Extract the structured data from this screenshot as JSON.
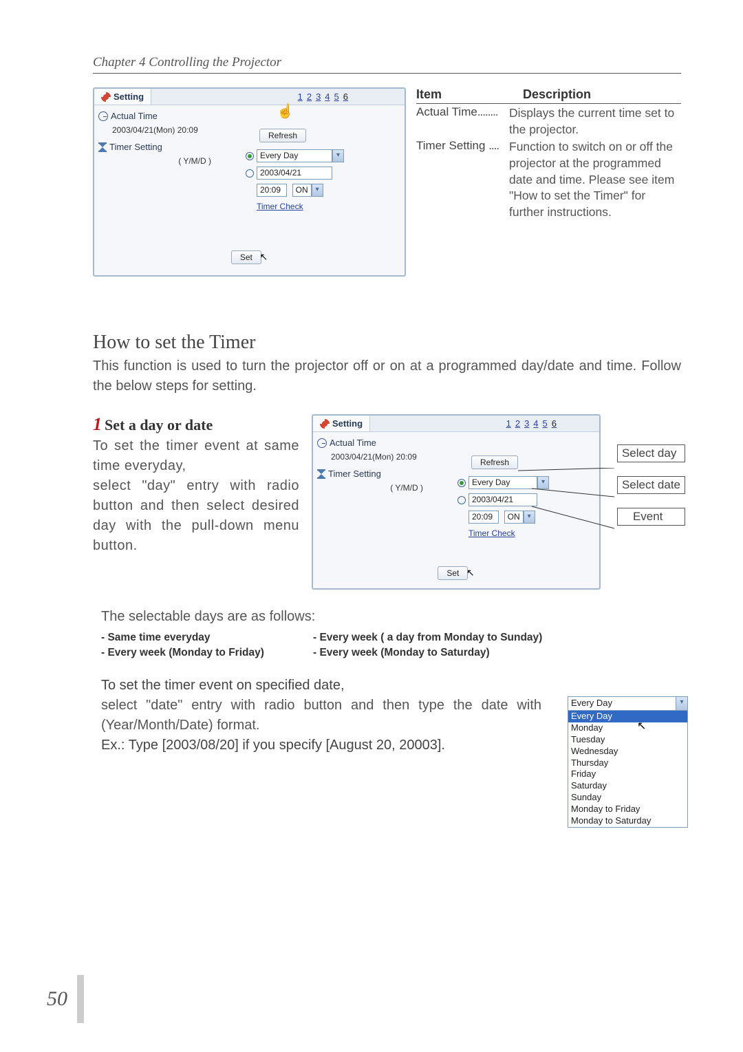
{
  "chapter": "Chapter 4 Controlling the Projector",
  "page_number": "50",
  "panel": {
    "tab_label": "Setting",
    "page_links": [
      "1",
      "2",
      "3",
      "4",
      "5",
      "6"
    ],
    "current_link": "6",
    "actual_time_label": "Actual Time",
    "actual_time_value": "2003/04/21(Mon) 20:09",
    "refresh_btn": "Refresh",
    "timer_setting_label": "Timer Setting",
    "ymd_label": "( Y/M/D )",
    "day_select_value": "Every Day",
    "date_input_value": "2003/04/21",
    "time_input_value": "20:09",
    "event_select_value": "ON",
    "timer_check_link": "Timer Check",
    "set_btn": "Set"
  },
  "desc_table": {
    "hdr_item": "Item",
    "hdr_desc": "Description",
    "row1_item": "Actual Time",
    "row1_dots": "........",
    "row1_desc": "Displays the current time set to the projector.",
    "row2_item": "Timer Setting",
    "row2_dots": "....",
    "row2_desc": "Function to switch on or off the projector at the programmed date and time. Please see item \"How to set the Timer\" for further instructions."
  },
  "section_title": "How to set the Timer",
  "section_intro": "This function is used to turn the projector off or on at a programmed day/date and time. Follow the below steps for setting.",
  "step1": {
    "num": "1",
    "title": "Set a day or date",
    "line1": "To set the timer event at same time everyday,",
    "line2": "select \"day\" entry with radio button and then select desired day with the pull-down menu button."
  },
  "callouts": {
    "select_day": "Select day",
    "select_date": "Select date",
    "event": "Event"
  },
  "selectable_heading": "The selectable days are as follows:",
  "day_options_list": [
    "Same time everyday",
    "Every week ( a day from Monday to Sunday)",
    "Every week (Monday to Friday)",
    "Every week (Monday to Saturday)"
  ],
  "dropdown": {
    "top_value": "Every Day",
    "items": [
      "Every Day",
      "Monday",
      "Tuesday",
      "Wednesday",
      "Thursday",
      "Friday",
      "Saturday",
      "Sunday",
      "Monday to Friday",
      "Monday to Saturday"
    ]
  },
  "para_date_title": "To set the timer event on specified date,",
  "para_date_body": "select \"date\" entry with radio button and then type the date with (Year/Month/Date) format.",
  "para_date_ex": "Ex.: Type [2003/08/20] if you specify [August 20, 20003]."
}
